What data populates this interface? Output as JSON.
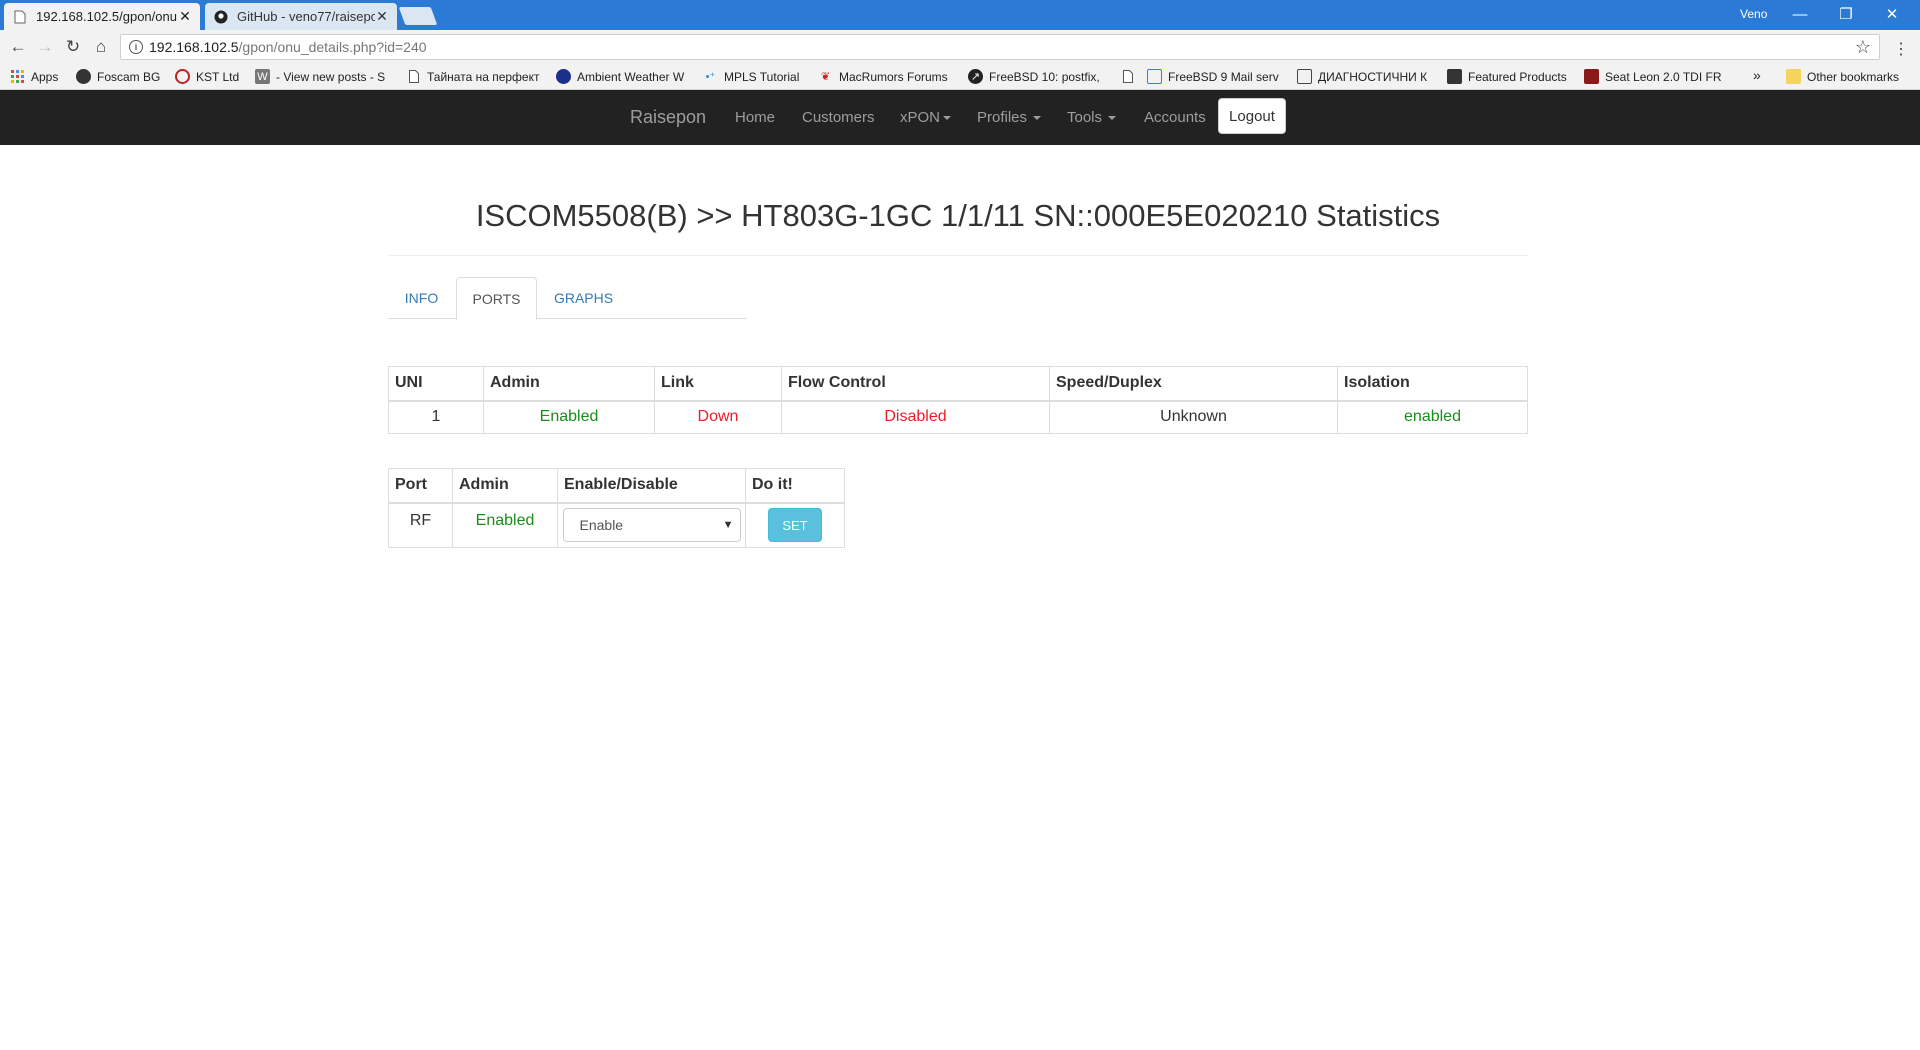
{
  "browser": {
    "tabs": [
      {
        "title": "192.168.102.5/gpon/onu",
        "favicon": "page-icon"
      },
      {
        "title": "GitHub - veno77/raisepo",
        "favicon": "github-icon"
      }
    ],
    "profile_name": "Veno",
    "address": {
      "host": "192.168.102.5",
      "path": "/gpon/onu_details.php?id=240"
    },
    "bookmarks": [
      {
        "label": "Apps",
        "icon": "apps-grid-icon"
      },
      {
        "label": "Foscam BG",
        "icon": "foscam-icon"
      },
      {
        "label": "KST Ltd",
        "icon": "kst-icon"
      },
      {
        "label": "- View new posts - S",
        "icon": "w-icon"
      },
      {
        "label": "Тайната на перфект",
        "icon": "page-icon"
      },
      {
        "label": "Ambient Weather W",
        "icon": "globe-icon"
      },
      {
        "label": "MPLS Tutorial",
        "icon": "mpls-icon"
      },
      {
        "label": "MacRumors Forums",
        "icon": "macrumors-icon"
      },
      {
        "label": "FreeBSD 10: postfix,",
        "icon": "freebsd-icon"
      },
      {
        "label": "",
        "icon": "page-icon"
      },
      {
        "label": "FreeBSD 9 Mail serv",
        "icon": "layout-icon"
      },
      {
        "label": "ДИАГНОСТИЧНИ К",
        "icon": "building-icon"
      },
      {
        "label": "Featured Products",
        "icon": "product-icon"
      },
      {
        "label": "Seat Leon 2.0 TDI FR",
        "icon": "car-icon"
      }
    ],
    "overflow_label": "»",
    "other_bookmarks": "Other bookmarks"
  },
  "navbar": {
    "brand": "Raisepon",
    "items": [
      {
        "label": "Home"
      },
      {
        "label": "Customers"
      },
      {
        "label": "xPON"
      },
      {
        "label": "Profiles"
      },
      {
        "label": "Tools"
      },
      {
        "label": "Accounts"
      }
    ],
    "logout": "Logout"
  },
  "page": {
    "title": "ISCOM5508(B) >> HT803G-1GC 1/1/11 SN::000E5E020210 Statistics",
    "tabs": [
      {
        "label": "INFO"
      },
      {
        "label": "PORTS",
        "active": true
      },
      {
        "label": "GRAPHS"
      }
    ]
  },
  "uni_table": {
    "headers": [
      "UNI",
      "Admin",
      "Link",
      "Flow Control",
      "Speed/Duplex",
      "Isolation"
    ],
    "row": {
      "uni": "1",
      "admin": "Enabled",
      "link": "Down",
      "flow": "Disabled",
      "speed": "Unknown",
      "isolation": "enabled"
    }
  },
  "rf_table": {
    "headers": [
      "Port",
      "Admin",
      "Enable/Disable",
      "Do it!"
    ],
    "row": {
      "port": "RF",
      "admin": "Enabled",
      "select_value": "Enable",
      "button": "SET"
    }
  },
  "colors": {
    "status_ok": "#1a8c1a",
    "status_bad": "#e8202a",
    "link_blue": "#337ab7",
    "button_info": "#5bc0de",
    "navbar": "#222222"
  }
}
